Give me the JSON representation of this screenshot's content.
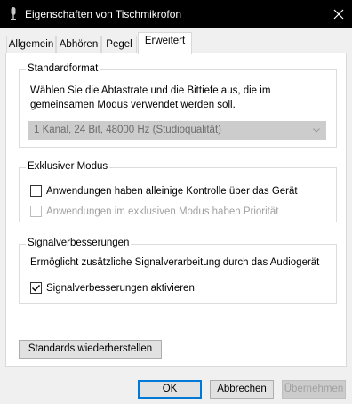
{
  "window": {
    "title": "Eigenschaften von Tischmikrofon",
    "icon": "microphone-icon",
    "close_icon": "close-icon"
  },
  "tabs": [
    {
      "label": "Allgemein",
      "active": false
    },
    {
      "label": "Abhören",
      "active": false
    },
    {
      "label": "Pegel",
      "active": false
    },
    {
      "label": "Erweitert",
      "active": true
    }
  ],
  "standardformat": {
    "legend": "Standardformat",
    "description_line1": "Wählen Sie die Abtastrate und die Bittiefe aus, die im",
    "description_line2": "gemeinsamen Modus verwendet werden soll.",
    "selected_format": "1 Kanal, 24 Bit, 48000 Hz (Studioqualität)",
    "enabled": false
  },
  "exclusive_mode": {
    "legend": "Exklusiver Modus",
    "option1_label": "Anwendungen haben alleinige Kontrolle über das Gerät",
    "option1_checked": false,
    "option1_enabled": true,
    "option2_label": "Anwendungen im exklusiven Modus haben Priorität",
    "option2_checked": false,
    "option2_enabled": false
  },
  "enhancements": {
    "legend": "Signalverbesserungen",
    "description": "Ermöglicht zusätzliche Signalverarbeitung durch das Audiogerät",
    "checkbox_label": "Signalverbesserungen aktivieren",
    "checked": true
  },
  "restore_button": "Standards wiederherstellen",
  "buttons": {
    "ok": "OK",
    "cancel": "Abbrechen",
    "apply": "Übernehmen",
    "apply_enabled": false
  },
  "colors": {
    "titlebar": "#000000",
    "accent": "#0078d7",
    "disabled_text": "#a0a0a0"
  }
}
